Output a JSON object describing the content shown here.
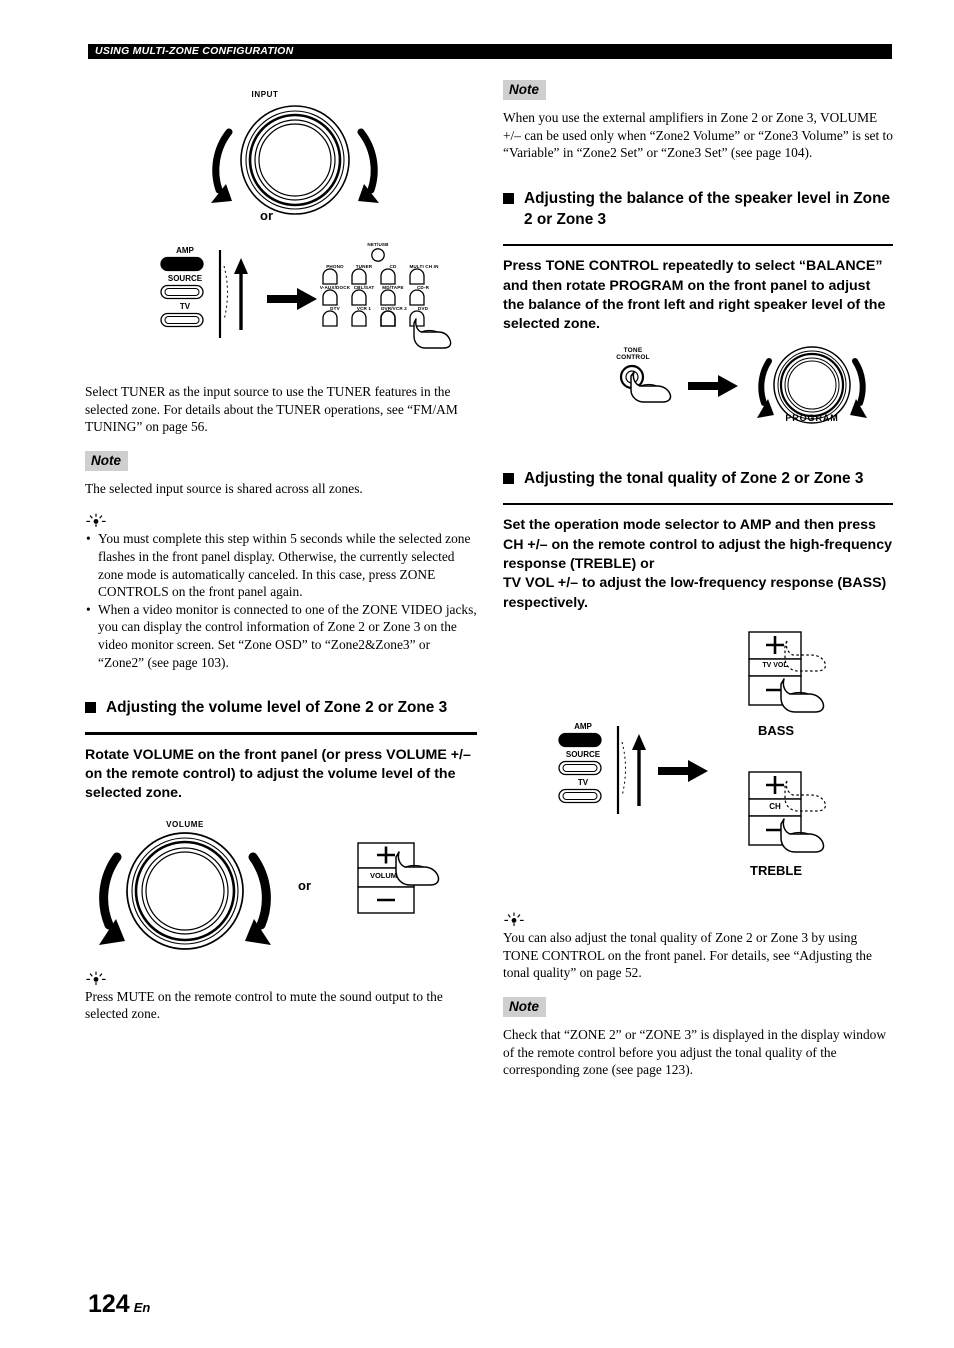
{
  "header": {
    "title": "USING MULTI-ZONE CONFIGURATION"
  },
  "footer": {
    "page_number": "124",
    "lang": "En"
  },
  "labels": {
    "or": "or",
    "note": "Note",
    "input_knob": "INPUT",
    "volume_knob": "VOLUME",
    "program_knob": "PROGRAM",
    "tone_control": "TONE\nCONTROL",
    "tone_control_line1": "TONE",
    "tone_control_line2": "CONTROL",
    "bass": "BASS",
    "treble": "TREBLE",
    "plus": "+",
    "minus": "–",
    "volume_rocker": "VOLUME",
    "tv_vol_rocker": "TV VOL",
    "ch_rocker": "CH"
  },
  "mode_selector": {
    "items": [
      {
        "label": "AMP",
        "selected": true
      },
      {
        "label": "SOURCE",
        "selected": false
      },
      {
        "label": "TV",
        "selected": false
      }
    ]
  },
  "input_buttons": {
    "top": "NET/USB",
    "rows": [
      [
        "PHONO",
        "TUNER",
        "CD",
        "MULTI CH IN"
      ],
      [
        "V-AUX/DOCK",
        "CBL/SAT",
        "MD/TAPE",
        "CD-R"
      ],
      [
        "DTV",
        "VCR 1",
        "DVR/VCR 2",
        "DVD"
      ]
    ]
  },
  "left_column": {
    "paragraph_tuner": "Select TUNER as the input source to use the TUNER features in the selected zone. For details about the TUNER operations, see “FM/AM TUNING” on page 56.",
    "note_shared_source": "The selected input source is shared across all zones.",
    "tips": [
      "You must complete this step within 5 seconds while the selected zone flashes in the front panel display. Otherwise, the currently selected zone mode is automatically canceled. In this case, press ZONE CONTROLS on the front panel again.",
      "When a video monitor is connected to one of the ZONE VIDEO jacks, you can display the control information of Zone 2 or Zone 3 on the video monitor screen. Set “Zone OSD” to “Zone2&Zone3” or “Zone2” (see page 103)."
    ],
    "section_volume": {
      "heading": "Adjusting the volume level of Zone 2 or Zone 3",
      "instruction": "Rotate VOLUME on the front panel (or press VOLUME +/– on the remote control) to adjust the volume level of the selected zone."
    },
    "tip_mute": "Press MUTE on the remote control to mute the sound output to the selected zone."
  },
  "right_column": {
    "note_external_amps": "When you use the external amplifiers in Zone 2 or Zone 3, VOLUME +/– can be used only when “Zone2 Volume” or “Zone3 Volume” is set to “Variable” in “Zone2 Set” or “Zone3 Set” (see page 104).",
    "section_balance": {
      "heading": "Adjusting the balance of the speaker level in Zone 2 or Zone 3",
      "instruction": "Press TONE CONTROL repeatedly to select “BALANCE” and then rotate PROGRAM on the front panel to adjust the balance of the front left and right speaker level of the selected zone."
    },
    "section_tonal": {
      "heading": "Adjusting the tonal quality of Zone 2 or Zone 3",
      "instruction": "Set the operation mode selector to AMP and then press CH +/– on the remote control to adjust the high-frequency response (TREBLE) or\nTV VOL +/– to adjust the low-frequency response (BASS) respectively."
    },
    "tip_tone_control": "You can also adjust the tonal quality of Zone 2 or Zone 3 by using TONE CONTROL on the front panel. For details, see “Adjusting the tonal quality” on page 52.",
    "note_zone_display": "Check that “ZONE 2” or “ZONE 3” is displayed in the display window of the remote control before you adjust the tonal quality of the corresponding zone (see page 123)."
  },
  "colors": {
    "ink": "#000000",
    "note_badge_bg": "#cfcfcf",
    "paper": "#ffffff"
  }
}
